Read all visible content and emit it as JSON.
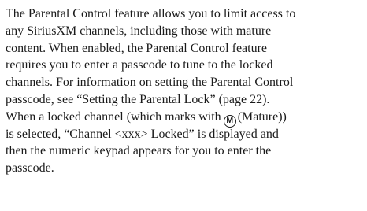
{
  "document": {
    "lines": [
      "The Parental Control feature allows you to limit access to",
      "any SiriusXM channels, including those with mature",
      "content. When enabled, the Parental Control feature",
      "requires you to enter a passcode to tune to the locked",
      "channels. For information on setting the Parental Control",
      "passcode, see “Setting the Parental Lock” (page 22)."
    ],
    "line7": {
      "before": "When a locked channel (which marks with",
      "badge": "M",
      "after": "(Mature))"
    },
    "lines_after": [
      "is selected, “Channel <xxx> Locked” is displayed and",
      "then the numeric keypad appears for you to enter the",
      "passcode."
    ]
  }
}
